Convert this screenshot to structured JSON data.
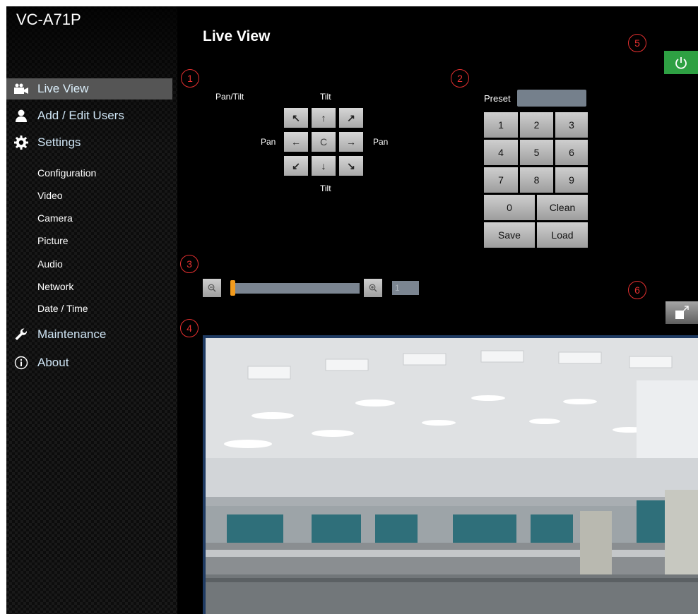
{
  "app": {
    "title": "VC-A71P"
  },
  "page": {
    "title": "Live View"
  },
  "sidebar": {
    "items": [
      {
        "label": "Live View",
        "icon": "video-camera-icon"
      },
      {
        "label": "Add / Edit Users",
        "icon": "user-icon"
      },
      {
        "label": "Settings",
        "icon": "gear-icon"
      },
      {
        "label": "Maintenance",
        "icon": "wrench-icon"
      },
      {
        "label": "About",
        "icon": "info-icon"
      }
    ],
    "settings_sub": [
      "Configuration",
      "Video",
      "Camera",
      "Picture",
      "Audio",
      "Network",
      "Date / Time"
    ]
  },
  "callouts": [
    "1",
    "2",
    "3",
    "4",
    "5",
    "6"
  ],
  "ptz": {
    "pan_tilt_label": "Pan/Tilt",
    "tilt_top": "Tilt",
    "tilt_bottom": "Tilt",
    "pan_left": "Pan",
    "pan_right": "Pan",
    "buttons": {
      "up_left": "↖",
      "up": "↑",
      "up_right": "↗",
      "left": "←",
      "center": "C",
      "right": "→",
      "down_left": "↙",
      "down": "↓",
      "down_right": "↘"
    }
  },
  "preset": {
    "label": "Preset",
    "value": "",
    "keys": [
      "1",
      "2",
      "3",
      "4",
      "5",
      "6",
      "7",
      "8",
      "9",
      "0"
    ],
    "clean": "Clean",
    "save": "Save",
    "load": "Load"
  },
  "zoom": {
    "value": "1",
    "level_fraction": 0.0
  },
  "colors": {
    "accent_orange": "#f29b1d",
    "power_green": "#2ea043",
    "callout_red": "#e53030",
    "nav_text": "#cfe5f5"
  }
}
